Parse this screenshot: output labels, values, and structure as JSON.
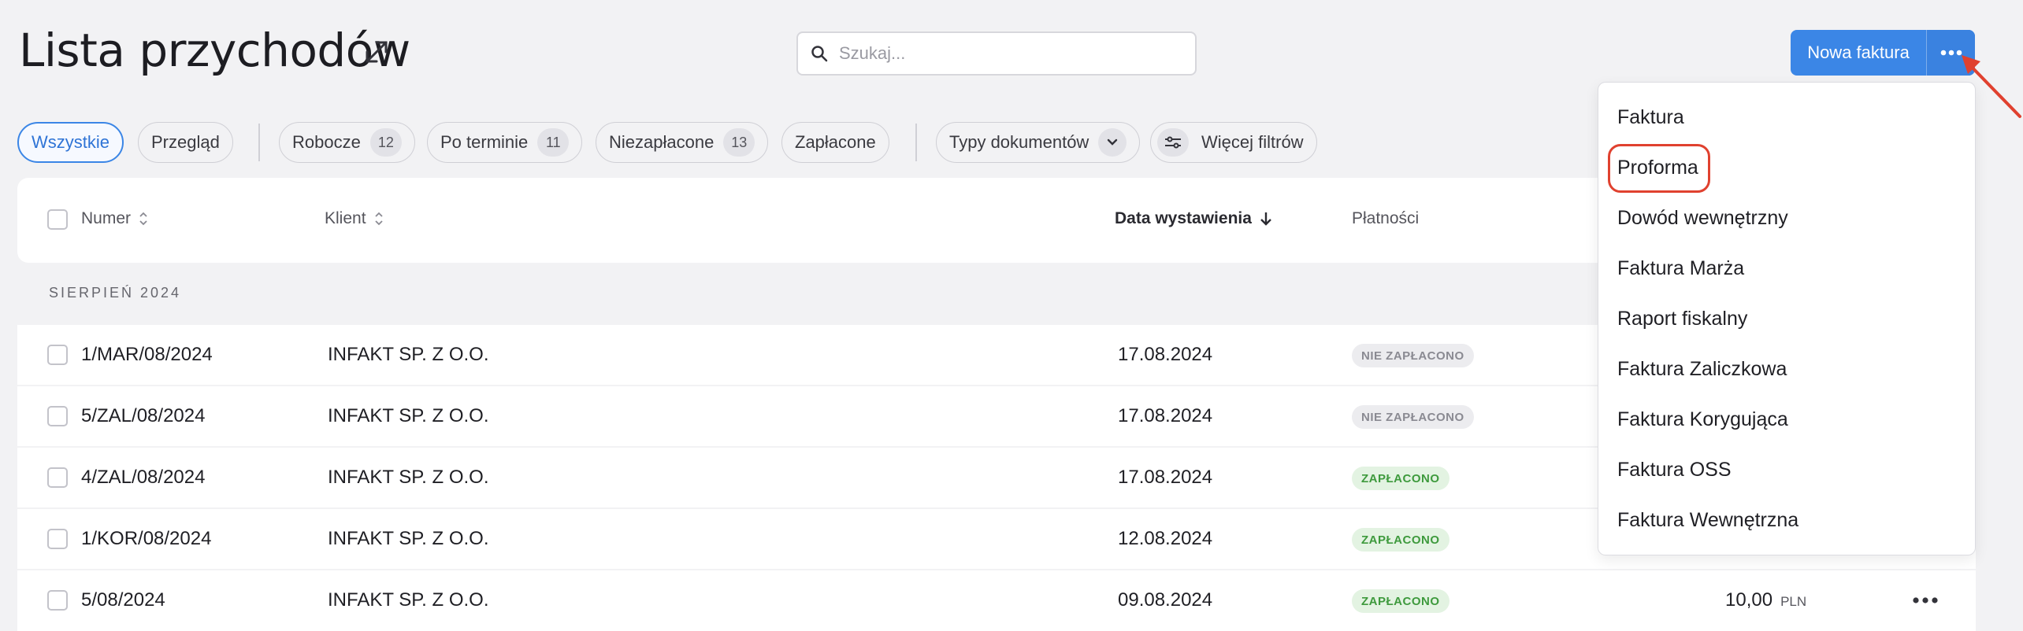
{
  "header": {
    "title": "Lista przychodów",
    "search_placeholder": "Szukaj...",
    "new_invoice_label": "Nowa faktura"
  },
  "filters": [
    {
      "label": "Wszystkie",
      "active": true
    },
    {
      "label": "Przegląd"
    },
    {
      "label": "Robocze",
      "count": "12"
    },
    {
      "label": "Po terminie",
      "count": "11"
    },
    {
      "label": "Niezapłacone",
      "count": "13"
    },
    {
      "label": "Zapłacone"
    },
    {
      "label": "Typy dokumentów"
    },
    {
      "label": "Więcej filtrów"
    }
  ],
  "table": {
    "columns": {
      "number": "Numer",
      "client": "Klient",
      "issue_date": "Data wystawienia",
      "payments": "Płatności"
    },
    "group_label": "SIERPIEŃ 2024",
    "rows": [
      {
        "number": "1/MAR/08/2024",
        "client": "INFAKT SP. Z O.O.",
        "date": "17.08.2024",
        "status": "NIE ZAPŁACONO",
        "status_type": "unpaid"
      },
      {
        "number": "5/ZAL/08/2024",
        "client": "INFAKT SP. Z O.O.",
        "date": "17.08.2024",
        "status": "NIE ZAPŁACONO",
        "status_type": "unpaid"
      },
      {
        "number": "4/ZAL/08/2024",
        "client": "INFAKT SP. Z O.O.",
        "date": "17.08.2024",
        "status": "ZAPŁACONO",
        "status_type": "paid"
      },
      {
        "number": "1/KOR/08/2024",
        "client": "INFAKT SP. Z O.O.",
        "date": "12.08.2024",
        "status": "ZAPŁACONO",
        "status_type": "paid"
      },
      {
        "number": "5/08/2024",
        "client": "INFAKT SP. Z O.O.",
        "date": "09.08.2024",
        "status": "ZAPŁACONO",
        "status_type": "paid",
        "amount": "10,00",
        "currency": "PLN"
      }
    ]
  },
  "dropdown": {
    "items": [
      "Faktura",
      "Proforma",
      "Dowód wewnętrzny",
      "Faktura Marża",
      "Raport fiskalny",
      "Faktura Zaliczkowa",
      "Faktura Korygująca",
      "Faktura OSS",
      "Faktura Wewnętrzna"
    ],
    "highlighted": "Proforma"
  },
  "colors": {
    "accent": "#3b86e6",
    "annotation": "#e0412f",
    "paid": "#3e9a3d"
  },
  "icons": [
    "expand-icon",
    "search-icon",
    "more-dots-icon",
    "sort-icon",
    "arrow-down-icon",
    "chevron-down-icon",
    "filter-sliders-icon"
  ]
}
